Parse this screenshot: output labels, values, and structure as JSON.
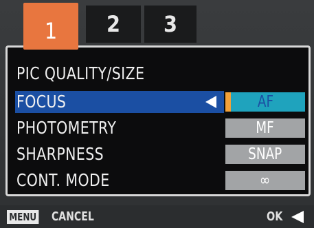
{
  "tabs": [
    {
      "label": "1",
      "active": true
    },
    {
      "label": "2",
      "active": false
    },
    {
      "label": "3",
      "active": false
    }
  ],
  "menu": {
    "items": [
      {
        "label": "PIC QUALITY/SIZE"
      },
      {
        "label": "FOCUS",
        "selected": true
      },
      {
        "label": "PHOTOMETRY"
      },
      {
        "label": "SHARPNESS"
      },
      {
        "label": "CONT. MODE"
      }
    ],
    "options": [
      {
        "label": "AF",
        "active": true
      },
      {
        "label": "MF"
      },
      {
        "label": "SNAP"
      },
      {
        "label": "∞"
      }
    ]
  },
  "footer": {
    "menu_key": "MENU",
    "cancel_label": "CANCEL",
    "ok_label": "OK"
  },
  "colors": {
    "active_tab": "#e8763f",
    "selection": "#1b4fa3",
    "active_option": "#1fa3bd",
    "option": "#a2a4a6"
  }
}
